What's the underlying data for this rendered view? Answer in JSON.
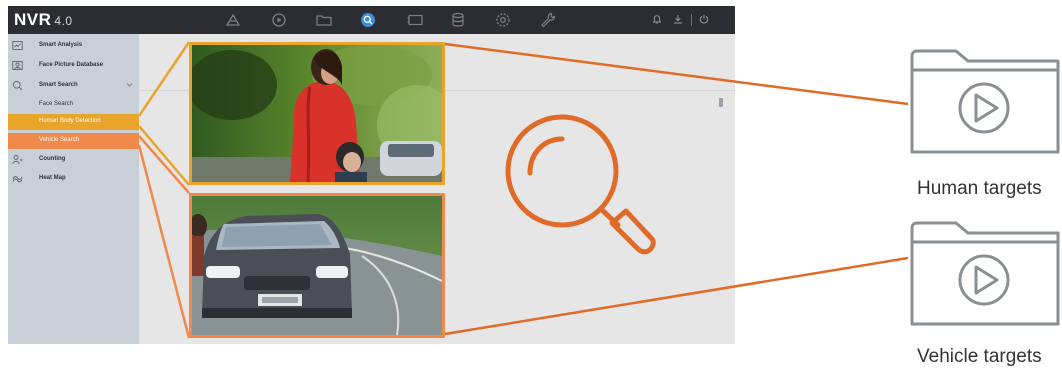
{
  "app": {
    "logo_text": "NVR",
    "logo_version": "4.0"
  },
  "toolbar": {
    "icons": [
      "live-view-icon",
      "playback-icon",
      "file-management-icon",
      "smart-analysis-icon",
      "configuration-icon",
      "storage-icon",
      "system-settings-icon",
      "maintenance-icon"
    ],
    "active_icon": "smart-analysis-icon",
    "right_icons": [
      "alarm-icon",
      "download-icon",
      "power-icon"
    ]
  },
  "sidebar": {
    "items": [
      {
        "label": "Smart Analysis",
        "icon": "smart-analysis-icon"
      },
      {
        "label": "Face Picture Database",
        "icon": "face-database-icon"
      },
      {
        "label": "Smart Search",
        "icon": "smart-search-icon"
      },
      {
        "label": "Face Search"
      },
      {
        "label": "Human Body Detection"
      },
      {
        "label": "Vehicle Search"
      },
      {
        "label": "Counting",
        "icon": "counting-icon"
      },
      {
        "label": "Heat Map",
        "icon": "heat-map-icon"
      }
    ],
    "active_human": "Human Body Detection",
    "active_vehicle": "Vehicle Search"
  },
  "targets": {
    "human_label": "Human targets",
    "vehicle_label": "Vehicle targets"
  },
  "colors": {
    "human_accent": "#e9a52b",
    "vehicle_accent": "#f08a4c",
    "topbar": "#2b2d33",
    "sidebar": "#c9cfd6",
    "active_toolbar_icon": "#3b8fd8"
  }
}
